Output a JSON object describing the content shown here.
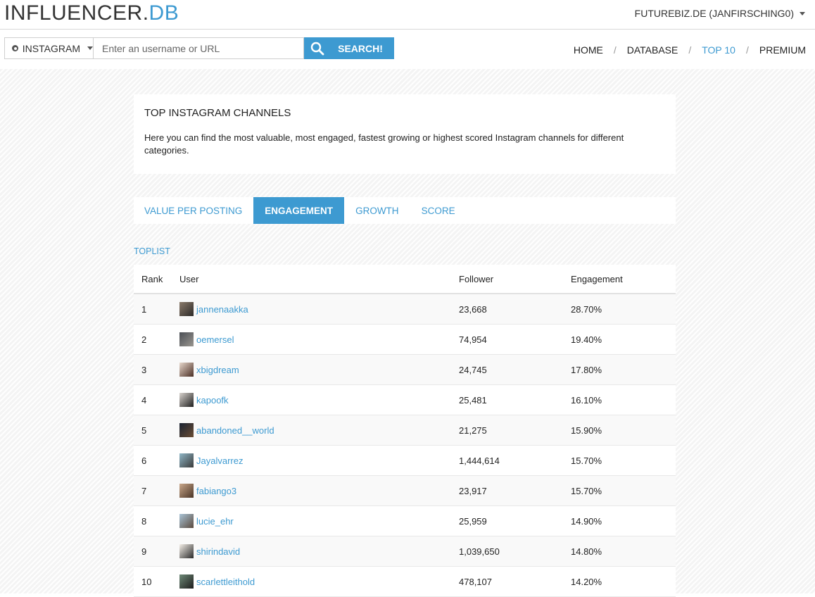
{
  "header": {
    "logo_main": "INFLUENCER.",
    "logo_accent": "DB",
    "user_account": "FUTUREBIZ.DE (JANFIRSCHING0)"
  },
  "search": {
    "platform": "INSTAGRAM",
    "placeholder": "Enter an username or URL",
    "button_label": "SEARCH!"
  },
  "nav": {
    "home": "HOME",
    "database": "DATABASE",
    "top10": "TOP 10",
    "premium": "PREMIUM",
    "separator": "/"
  },
  "intro": {
    "title": "TOP INSTAGRAM CHANNELS",
    "text": "Here you can find the most valuable, most engaged, fastest growing or highest scored Instagram channels for different categories."
  },
  "tabs": [
    "VALUE PER POSTING",
    "ENGAGEMENT",
    "GROWTH",
    "SCORE"
  ],
  "active_tab": "ENGAGEMENT",
  "toplist": {
    "label": "TOPLIST",
    "columns": {
      "rank": "Rank",
      "user": "User",
      "follower": "Follower",
      "engagement": "Engagement"
    },
    "rows": [
      {
        "rank": "1",
        "user": "jannenaakka",
        "follower": "23,668",
        "engagement": "28.70%"
      },
      {
        "rank": "2",
        "user": "oemersel",
        "follower": "74,954",
        "engagement": "19.40%"
      },
      {
        "rank": "3",
        "user": "xbigdream",
        "follower": "24,745",
        "engagement": "17.80%"
      },
      {
        "rank": "4",
        "user": "kapoofk",
        "follower": "25,481",
        "engagement": "16.10%"
      },
      {
        "rank": "5",
        "user": "abandoned__world",
        "follower": "21,275",
        "engagement": "15.90%"
      },
      {
        "rank": "6",
        "user": "Jayalvarrez",
        "follower": "1,444,614",
        "engagement": "15.70%"
      },
      {
        "rank": "7",
        "user": "fabiango3",
        "follower": "23,917",
        "engagement": "15.70%"
      },
      {
        "rank": "8",
        "user": "lucie_ehr",
        "follower": "25,959",
        "engagement": "14.90%"
      },
      {
        "rank": "9",
        "user": "shirindavid",
        "follower": "1,039,650",
        "engagement": "14.80%"
      },
      {
        "rank": "10",
        "user": "scarlettleithold",
        "follower": "478,107",
        "engagement": "14.20%"
      }
    ]
  },
  "colors": {
    "accent": "#3d9ad1"
  }
}
